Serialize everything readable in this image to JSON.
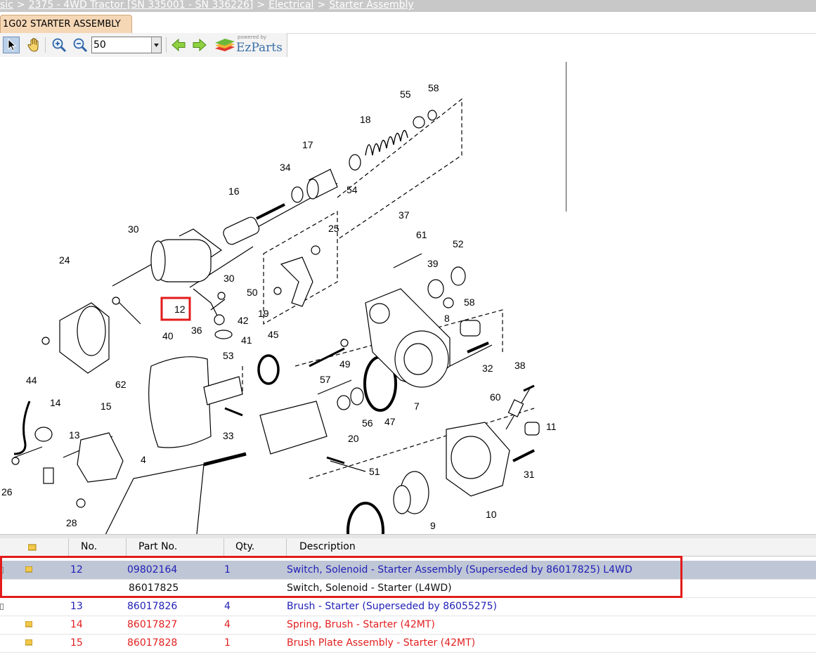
{
  "breadcrumb": {
    "items": [
      "sic",
      "2375 - 4WD Tractor [SN 335001 - SN 336226]",
      "Electrical",
      "Starter Assembly"
    ],
    "separator": ">"
  },
  "tab": {
    "label": "1G02 STARTER ASSEMBLY"
  },
  "toolbar": {
    "zoom_value": "50",
    "logo_powered": "powered by",
    "logo_text": "EzParts"
  },
  "diagram": {
    "callouts": [
      "55",
      "58",
      "18",
      "17",
      "34",
      "54",
      "16",
      "30",
      "25",
      "37",
      "61",
      "52",
      "24",
      "39",
      "50",
      "58",
      "19",
      "30",
      "12",
      "42",
      "36",
      "41",
      "8",
      "40",
      "45",
      "49",
      "32",
      "53",
      "38",
      "62",
      "57",
      "47",
      "7",
      "44",
      "14",
      "15",
      "56",
      "60",
      "11",
      "13",
      "20",
      "33",
      "51",
      "4",
      "31",
      "26",
      "10",
      "28",
      "9"
    ]
  },
  "colors": {
    "highlight": "#e31b1b",
    "selected_row": "#bfc6d6",
    "link_blue": "#1f1fb5",
    "warn_red": "#e21f1f"
  },
  "table": {
    "headers": {
      "no": "No.",
      "part": "Part No.",
      "qty": "Qty.",
      "desc": "Description"
    },
    "rows": [
      {
        "no": "12",
        "part": "09802164",
        "qty": "1",
        "desc": "Switch, Solenoid - Starter Assembly (Superseded by 86017825) L4WD"
      },
      {
        "no": "",
        "part": "86017825",
        "qty": "",
        "desc": "Switch, Solenoid - Starter (L4WD)"
      },
      {
        "no": "13",
        "part": "86017826",
        "qty": "4",
        "desc": "Brush - Starter (Superseded by 86055275)"
      },
      {
        "no": "14",
        "part": "86017827",
        "qty": "4",
        "desc": "Spring, Brush - Starter (42MT)"
      },
      {
        "no": "15",
        "part": "86017828",
        "qty": "1",
        "desc": "Brush Plate Assembly - Starter (42MT)"
      }
    ]
  }
}
